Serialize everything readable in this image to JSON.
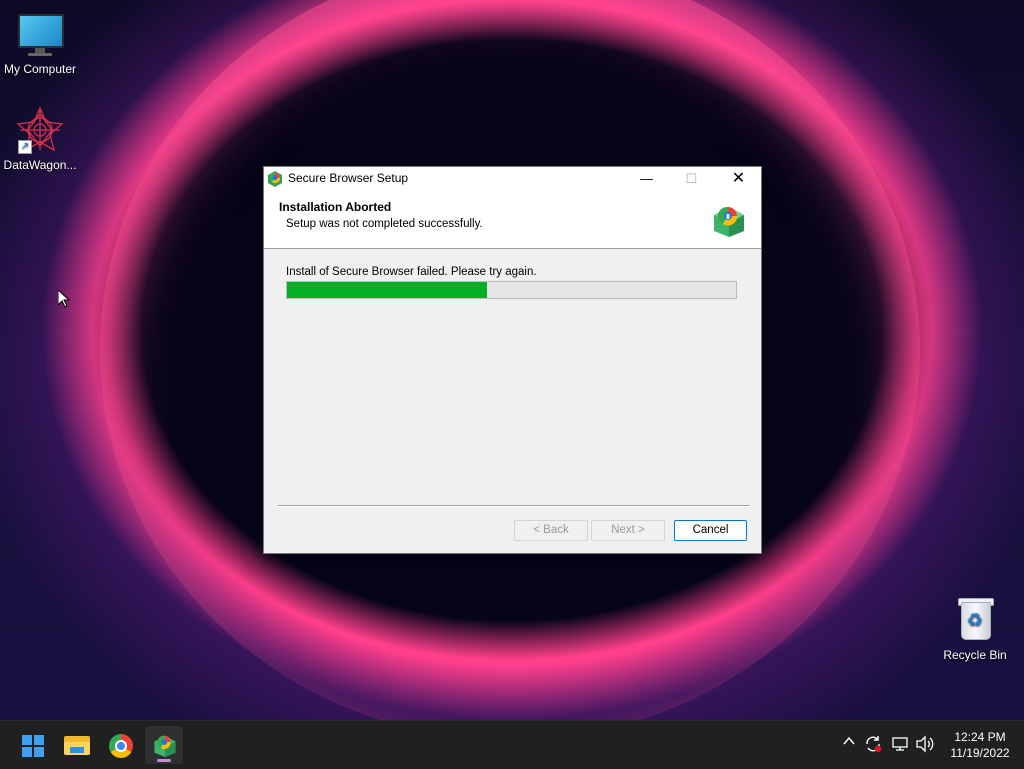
{
  "desktop": {
    "icons": [
      {
        "label": "My Computer"
      },
      {
        "label": "DataWagon..."
      },
      {
        "label": "Recycle Bin"
      }
    ]
  },
  "dialog": {
    "title": "Secure Browser Setup",
    "header_title": "Installation Aborted",
    "header_subtitle": "Setup was not completed successfully.",
    "status_text": "Install of Secure Browser failed. Please try again.",
    "progress_fraction": 0.445,
    "progress_color": "#06b025",
    "buttons": {
      "back": "< Back",
      "next": "Next >",
      "cancel": "Cancel"
    },
    "window_controls": {
      "minimize": "—",
      "maximize": "☐",
      "close": "✕"
    }
  },
  "taskbar": {
    "apps": [
      {
        "name": "start-icon"
      },
      {
        "name": "file-explorer-icon"
      },
      {
        "name": "chrome-icon"
      },
      {
        "name": "secure-browser-setup-icon",
        "active": true
      }
    ],
    "tray": {
      "chevron": "^",
      "time": "12:24 PM",
      "date": "11/19/2022"
    }
  }
}
